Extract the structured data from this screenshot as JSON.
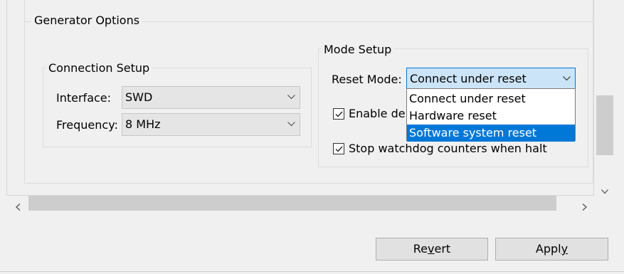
{
  "generator_options": {
    "title": "Generator Options"
  },
  "connection_setup": {
    "title": "Connection Setup",
    "interface_label": "Interface:",
    "interface_value": "SWD",
    "frequency_label": "Frequency:",
    "frequency_value": "8 MHz"
  },
  "mode_setup": {
    "title": "Mode Setup",
    "reset_mode_label": "Reset Mode:",
    "reset_mode_value": "Connect under reset",
    "reset_mode_options": [
      "Connect under reset",
      "Hardware reset",
      "Software system reset"
    ],
    "highlighted_option": "Software system reset",
    "enable_checkbox_label": "Enable del",
    "enable_checked": true,
    "watchdog_checkbox_label": "Stop watchdog counters when halt",
    "watchdog_checked": true
  },
  "buttons": {
    "revert": {
      "label_before": "Re",
      "mnemonic": "v",
      "label_after": "ert"
    },
    "apply": {
      "label_before": "Appl",
      "mnemonic": "y",
      "label_after": ""
    }
  },
  "colors": {
    "accent": "#0078d7",
    "selected_combo_bg": "#cce4f7"
  }
}
